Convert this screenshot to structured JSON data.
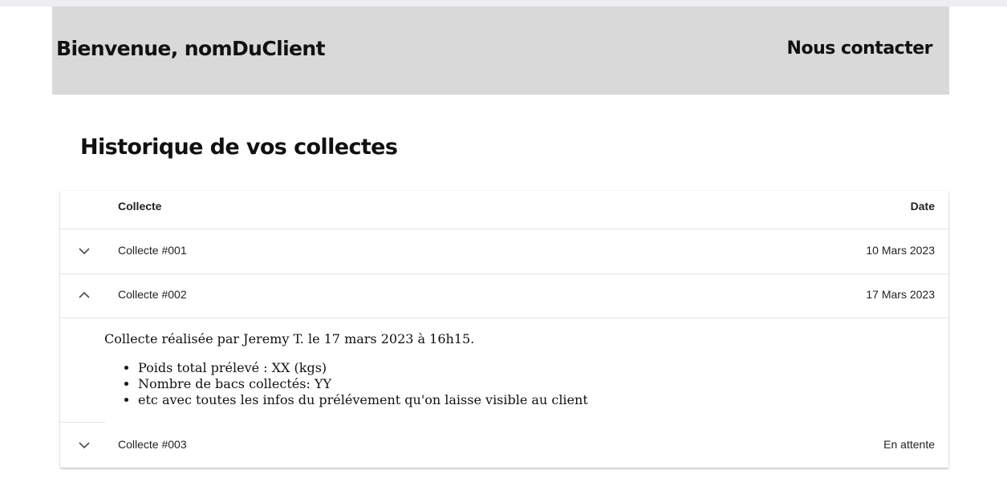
{
  "header": {
    "welcome": "Bienvenue, nomDuClient",
    "contact_label": "Nous contacter",
    "background_color": "#d9d9d9"
  },
  "page": {
    "title": "Historique de vos collectes"
  },
  "table": {
    "columns": {
      "collecte": "Collecte",
      "date": "Date"
    },
    "rows": [
      {
        "name": "Collecte #001",
        "date": "10 Mars 2023",
        "expanded": false,
        "toggle_icon": "chevron-down-icon"
      },
      {
        "name": "Collecte #002",
        "date": "17 Mars 2023",
        "expanded": true,
        "toggle_icon": "chevron-up-icon"
      },
      {
        "name": "Collecte #003",
        "date": "En attente",
        "expanded": false,
        "toggle_icon": "chevron-down-icon"
      }
    ],
    "details": {
      "summary": "Collecte réalisée par Jeremy T. le 17 mars 2023 à 16h15.",
      "items": [
        "Poids total prélevé : XX (kgs)",
        "Nombre de bacs collectés: YY",
        "etc avec toutes les infos du prélévement qu'on laisse visible au client"
      ]
    }
  }
}
